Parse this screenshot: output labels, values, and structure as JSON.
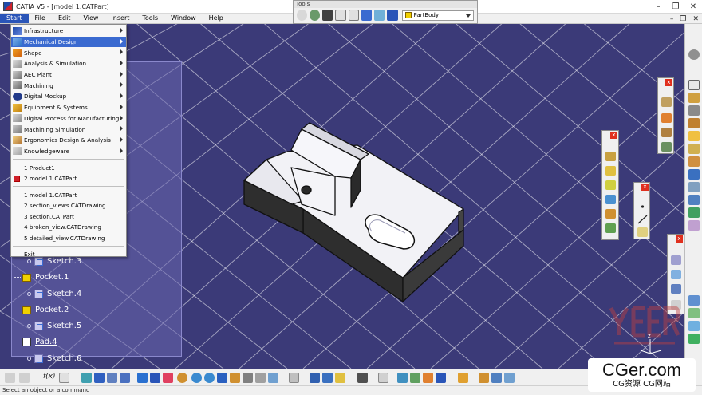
{
  "window": {
    "title": "CATIA V5 - [model 1.CATPart]",
    "controls": [
      "–",
      "❐",
      "✕"
    ]
  },
  "menubar": {
    "items": [
      "Start",
      "File",
      "Edit",
      "View",
      "Insert",
      "Tools",
      "Window",
      "Help"
    ],
    "active_item": "Start",
    "right_controls": [
      "–",
      "❐",
      "✕"
    ]
  },
  "start_menu": {
    "workbenches": [
      {
        "label": "Infrastructure",
        "icon": "infrastructure-icon",
        "submenu": true
      },
      {
        "label": "Mechanical Design",
        "icon": "mechanical-design-icon",
        "submenu": true,
        "highlighted": true
      },
      {
        "label": "Shape",
        "icon": "shape-icon",
        "submenu": true
      },
      {
        "label": "Analysis & Simulation",
        "icon": "analysis-icon",
        "submenu": true
      },
      {
        "label": "AEC Plant",
        "icon": "aec-plant-icon",
        "submenu": true
      },
      {
        "label": "Machining",
        "icon": "machining-icon",
        "submenu": true
      },
      {
        "label": "Digital Mockup",
        "icon": "digital-mockup-icon",
        "submenu": true
      },
      {
        "label": "Equipment & Systems",
        "icon": "equipment-icon",
        "submenu": true
      },
      {
        "label": "Digital Process for Manufacturing",
        "icon": "process-icon",
        "submenu": true
      },
      {
        "label": "Machining Simulation",
        "icon": "machining-sim-icon",
        "submenu": true
      },
      {
        "label": "Ergonomics Design & Analysis",
        "icon": "ergonomics-icon",
        "submenu": true
      },
      {
        "label": "Knowledgeware",
        "icon": "knowledgeware-icon",
        "submenu": true
      }
    ],
    "open_docs": [
      {
        "label": "1 Product1"
      },
      {
        "label": "2 model 1.CATPart"
      }
    ],
    "recent_files": [
      {
        "label": "1 model 1.CATPart"
      },
      {
        "label": "2 section_views.CATDrawing"
      },
      {
        "label": "3 section.CATPart"
      },
      {
        "label": "4 broken_view.CATDrawing"
      },
      {
        "label": "5 detailed_view.CATDrawing"
      }
    ],
    "exit_label": "Exit"
  },
  "tools_toolbar": {
    "title": "Tools",
    "current_body": "PartBody"
  },
  "tree": {
    "nodes": [
      {
        "label": "Sketch.3",
        "type": "sketch"
      },
      {
        "label": "Pocket.1",
        "type": "feature"
      },
      {
        "label": "Sketch.4",
        "type": "sketch"
      },
      {
        "label": "Pocket.2",
        "type": "feature"
      },
      {
        "label": "Sketch.5",
        "type": "sketch"
      },
      {
        "label": "Pad.4",
        "type": "pad"
      },
      {
        "label": "Sketch.6",
        "type": "sketch"
      }
    ]
  },
  "bottom_toolbar": {
    "formula_label": "f(x)"
  },
  "statusbar": {
    "message": "Select an object or a command"
  },
  "watermark": {
    "main": "CGer.com",
    "sub": "CG资源 CG网站"
  },
  "colors": {
    "viewport_bg": "#3b3a78",
    "menu_highlight": "#3a6ad0",
    "part_face": "#f2f2f6",
    "part_edge": "#111111"
  }
}
